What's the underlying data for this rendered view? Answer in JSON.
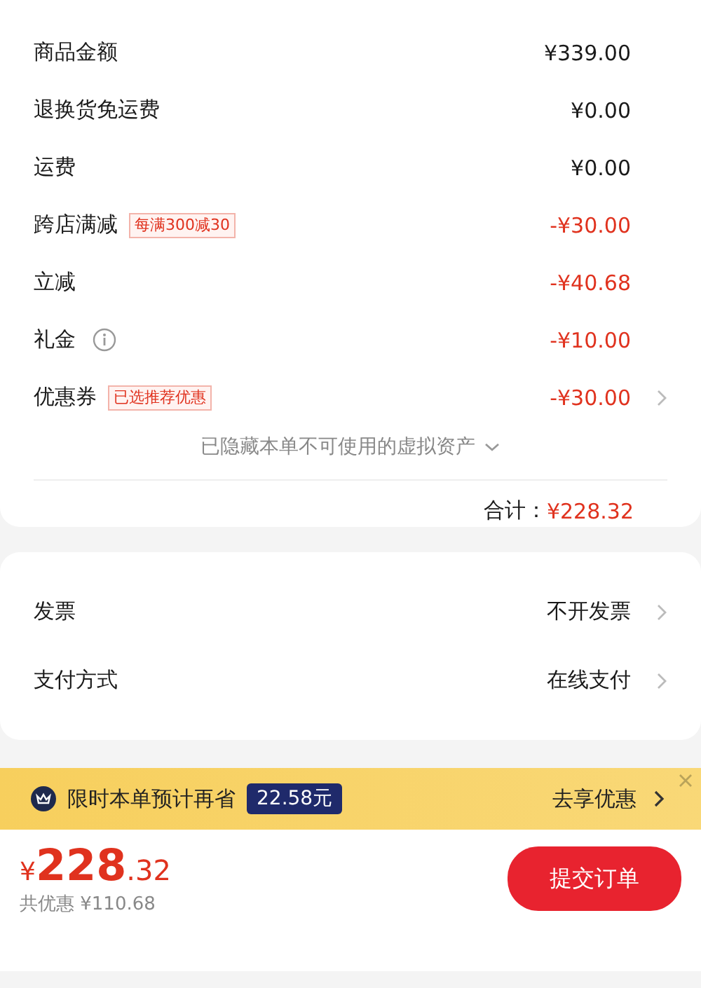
{
  "price_rows": [
    {
      "label": "商品金额",
      "amount": "¥339.00",
      "kind": "charge",
      "has_chevron": false
    },
    {
      "label": "退换货免运费",
      "amount": "¥0.00",
      "kind": "charge",
      "has_chevron": false
    },
    {
      "label": "运费",
      "amount": "¥0.00",
      "kind": "charge",
      "has_chevron": false
    },
    {
      "label": "跨店满减",
      "tag": "每满300减30",
      "amount": "-¥30.00",
      "kind": "discount",
      "has_chevron": false
    },
    {
      "label": "立减",
      "amount": "-¥40.68",
      "kind": "discount",
      "has_chevron": false
    },
    {
      "label": "礼金",
      "info": true,
      "amount": "-¥10.00",
      "kind": "discount",
      "has_chevron": false
    },
    {
      "label": "优惠券",
      "tag": "已选推荐优惠",
      "amount": "-¥30.00",
      "kind": "discount",
      "has_chevron": true
    }
  ],
  "hidden_assets_note": "已隐藏本单不可使用的虚拟资产",
  "total": {
    "label": "合计：",
    "amount": "¥228.32"
  },
  "settings": [
    {
      "label": "发票",
      "value": "不开发票"
    },
    {
      "label": "支付方式",
      "value": "在线支付"
    }
  ],
  "promo_banner": {
    "text": "限时本单预计再省",
    "badge": "22.58元",
    "action": "去享优惠"
  },
  "checkout": {
    "currency": "¥",
    "price_integer": "228",
    "price_decimal": ".32",
    "savings": "共优惠 ¥110.68",
    "submit": "提交订单"
  }
}
